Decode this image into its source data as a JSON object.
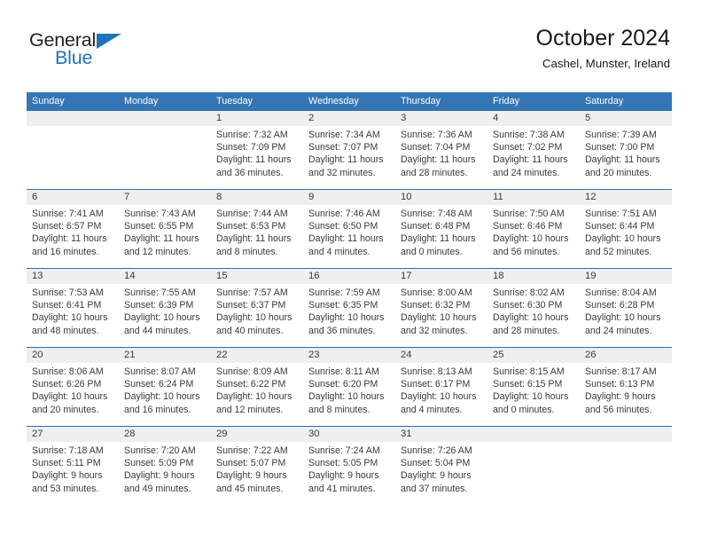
{
  "brand": {
    "name_top": "General",
    "name_bottom": "Blue",
    "color_black": "#231f20",
    "color_blue": "#1f72bd"
  },
  "header": {
    "title": "October 2024",
    "subtitle": "Cashel, Munster, Ireland"
  },
  "theme": {
    "header_blue": "#3476b5",
    "rule_blue": "#2e6da8",
    "day_band_gray": "#efefef",
    "text": "#3a3a3a"
  },
  "weekdays": [
    "Sunday",
    "Monday",
    "Tuesday",
    "Wednesday",
    "Thursday",
    "Friday",
    "Saturday"
  ],
  "weeks": [
    [
      {
        "day": "",
        "lines": []
      },
      {
        "day": "",
        "lines": []
      },
      {
        "day": "1",
        "lines": [
          "Sunrise: 7:32 AM",
          "Sunset: 7:09 PM",
          "Daylight: 11 hours",
          "and 36 minutes."
        ]
      },
      {
        "day": "2",
        "lines": [
          "Sunrise: 7:34 AM",
          "Sunset: 7:07 PM",
          "Daylight: 11 hours",
          "and 32 minutes."
        ]
      },
      {
        "day": "3",
        "lines": [
          "Sunrise: 7:36 AM",
          "Sunset: 7:04 PM",
          "Daylight: 11 hours",
          "and 28 minutes."
        ]
      },
      {
        "day": "4",
        "lines": [
          "Sunrise: 7:38 AM",
          "Sunset: 7:02 PM",
          "Daylight: 11 hours",
          "and 24 minutes."
        ]
      },
      {
        "day": "5",
        "lines": [
          "Sunrise: 7:39 AM",
          "Sunset: 7:00 PM",
          "Daylight: 11 hours",
          "and 20 minutes."
        ]
      }
    ],
    [
      {
        "day": "6",
        "lines": [
          "Sunrise: 7:41 AM",
          "Sunset: 6:57 PM",
          "Daylight: 11 hours",
          "and 16 minutes."
        ]
      },
      {
        "day": "7",
        "lines": [
          "Sunrise: 7:43 AM",
          "Sunset: 6:55 PM",
          "Daylight: 11 hours",
          "and 12 minutes."
        ]
      },
      {
        "day": "8",
        "lines": [
          "Sunrise: 7:44 AM",
          "Sunset: 6:53 PM",
          "Daylight: 11 hours",
          "and 8 minutes."
        ]
      },
      {
        "day": "9",
        "lines": [
          "Sunrise: 7:46 AM",
          "Sunset: 6:50 PM",
          "Daylight: 11 hours",
          "and 4 minutes."
        ]
      },
      {
        "day": "10",
        "lines": [
          "Sunrise: 7:48 AM",
          "Sunset: 6:48 PM",
          "Daylight: 11 hours",
          "and 0 minutes."
        ]
      },
      {
        "day": "11",
        "lines": [
          "Sunrise: 7:50 AM",
          "Sunset: 6:46 PM",
          "Daylight: 10 hours",
          "and 56 minutes."
        ]
      },
      {
        "day": "12",
        "lines": [
          "Sunrise: 7:51 AM",
          "Sunset: 6:44 PM",
          "Daylight: 10 hours",
          "and 52 minutes."
        ]
      }
    ],
    [
      {
        "day": "13",
        "lines": [
          "Sunrise: 7:53 AM",
          "Sunset: 6:41 PM",
          "Daylight: 10 hours",
          "and 48 minutes."
        ]
      },
      {
        "day": "14",
        "lines": [
          "Sunrise: 7:55 AM",
          "Sunset: 6:39 PM",
          "Daylight: 10 hours",
          "and 44 minutes."
        ]
      },
      {
        "day": "15",
        "lines": [
          "Sunrise: 7:57 AM",
          "Sunset: 6:37 PM",
          "Daylight: 10 hours",
          "and 40 minutes."
        ]
      },
      {
        "day": "16",
        "lines": [
          "Sunrise: 7:59 AM",
          "Sunset: 6:35 PM",
          "Daylight: 10 hours",
          "and 36 minutes."
        ]
      },
      {
        "day": "17",
        "lines": [
          "Sunrise: 8:00 AM",
          "Sunset: 6:32 PM",
          "Daylight: 10 hours",
          "and 32 minutes."
        ]
      },
      {
        "day": "18",
        "lines": [
          "Sunrise: 8:02 AM",
          "Sunset: 6:30 PM",
          "Daylight: 10 hours",
          "and 28 minutes."
        ]
      },
      {
        "day": "19",
        "lines": [
          "Sunrise: 8:04 AM",
          "Sunset: 6:28 PM",
          "Daylight: 10 hours",
          "and 24 minutes."
        ]
      }
    ],
    [
      {
        "day": "20",
        "lines": [
          "Sunrise: 8:06 AM",
          "Sunset: 6:26 PM",
          "Daylight: 10 hours",
          "and 20 minutes."
        ]
      },
      {
        "day": "21",
        "lines": [
          "Sunrise: 8:07 AM",
          "Sunset: 6:24 PM",
          "Daylight: 10 hours",
          "and 16 minutes."
        ]
      },
      {
        "day": "22",
        "lines": [
          "Sunrise: 8:09 AM",
          "Sunset: 6:22 PM",
          "Daylight: 10 hours",
          "and 12 minutes."
        ]
      },
      {
        "day": "23",
        "lines": [
          "Sunrise: 8:11 AM",
          "Sunset: 6:20 PM",
          "Daylight: 10 hours",
          "and 8 minutes."
        ]
      },
      {
        "day": "24",
        "lines": [
          "Sunrise: 8:13 AM",
          "Sunset: 6:17 PM",
          "Daylight: 10 hours",
          "and 4 minutes."
        ]
      },
      {
        "day": "25",
        "lines": [
          "Sunrise: 8:15 AM",
          "Sunset: 6:15 PM",
          "Daylight: 10 hours",
          "and 0 minutes."
        ]
      },
      {
        "day": "26",
        "lines": [
          "Sunrise: 8:17 AM",
          "Sunset: 6:13 PM",
          "Daylight: 9 hours",
          "and 56 minutes."
        ]
      }
    ],
    [
      {
        "day": "27",
        "lines": [
          "Sunrise: 7:18 AM",
          "Sunset: 5:11 PM",
          "Daylight: 9 hours",
          "and 53 minutes."
        ]
      },
      {
        "day": "28",
        "lines": [
          "Sunrise: 7:20 AM",
          "Sunset: 5:09 PM",
          "Daylight: 9 hours",
          "and 49 minutes."
        ]
      },
      {
        "day": "29",
        "lines": [
          "Sunrise: 7:22 AM",
          "Sunset: 5:07 PM",
          "Daylight: 9 hours",
          "and 45 minutes."
        ]
      },
      {
        "day": "30",
        "lines": [
          "Sunrise: 7:24 AM",
          "Sunset: 5:05 PM",
          "Daylight: 9 hours",
          "and 41 minutes."
        ]
      },
      {
        "day": "31",
        "lines": [
          "Sunrise: 7:26 AM",
          "Sunset: 5:04 PM",
          "Daylight: 9 hours",
          "and 37 minutes."
        ]
      },
      {
        "day": "",
        "lines": []
      },
      {
        "day": "",
        "lines": []
      }
    ]
  ]
}
